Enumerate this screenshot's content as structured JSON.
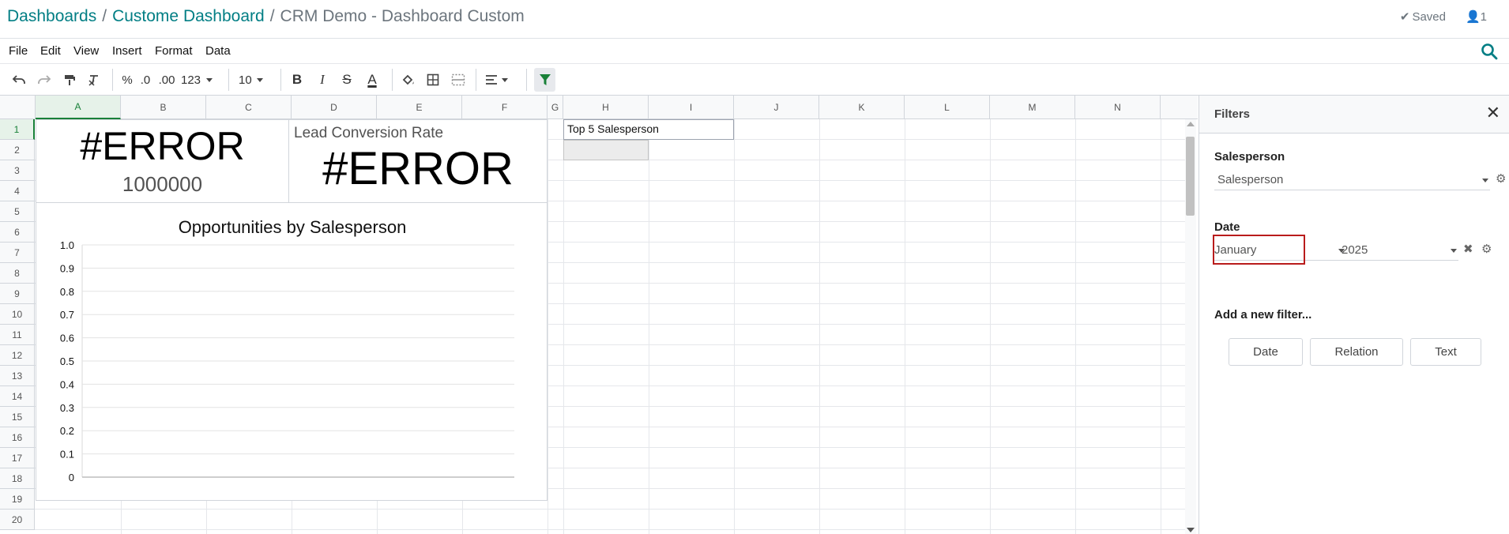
{
  "breadcrumb": {
    "item1": "Dashboards",
    "item2": "Custome Dashboard",
    "current": "CRM Demo - Dashboard Custom",
    "separator": "/"
  },
  "status": {
    "saved": "Saved",
    "users": "1"
  },
  "menu": [
    "File",
    "Edit",
    "View",
    "Insert",
    "Format",
    "Data"
  ],
  "toolbar": {
    "percent": "%",
    "decimal_dec": ".0",
    "decimal_inc": ".00",
    "number_format": "123",
    "font_size": "10",
    "bold": "B",
    "italic": "I",
    "strike": "S",
    "text_color": "A"
  },
  "grid": {
    "columns": [
      "A",
      "B",
      "C",
      "D",
      "E",
      "F",
      "G",
      "H",
      "I",
      "J",
      "K",
      "L",
      "M",
      "N"
    ],
    "rows": [
      "1",
      "2",
      "3",
      "4",
      "5",
      "6",
      "7",
      "8",
      "9",
      "10",
      "11",
      "12",
      "13",
      "14",
      "15",
      "16",
      "17",
      "18",
      "19",
      "20"
    ],
    "active_column": "A",
    "active_row": "1",
    "h1_text": "Top 5 Salesperson"
  },
  "scorecard1": {
    "value": "#ERROR",
    "baseline": "1000000"
  },
  "scorecard2": {
    "title": "Lead Conversion Rate",
    "value": "#ERROR"
  },
  "chart_data": {
    "type": "bar",
    "title": "Opportunities by Salesperson",
    "categories": [],
    "series": [],
    "ylim": [
      0,
      1
    ],
    "yticks": [
      "1.0",
      "0.9",
      "0.8",
      "0.7",
      "0.6",
      "0.5",
      "0.4",
      "0.3",
      "0.2",
      "0.1",
      "0"
    ],
    "grid": true
  },
  "filters": {
    "title": "Filters",
    "salesperson_label": "Salesperson",
    "salesperson_value": "Salesperson",
    "date_label": "Date",
    "month_value": "January",
    "year_value": "2025",
    "add_label": "Add a new filter...",
    "add_buttons": [
      "Date",
      "Relation",
      "Text"
    ]
  },
  "colors": {
    "brand": "#017e84",
    "highlight": "#b91c1c",
    "active_green": "#188038"
  }
}
